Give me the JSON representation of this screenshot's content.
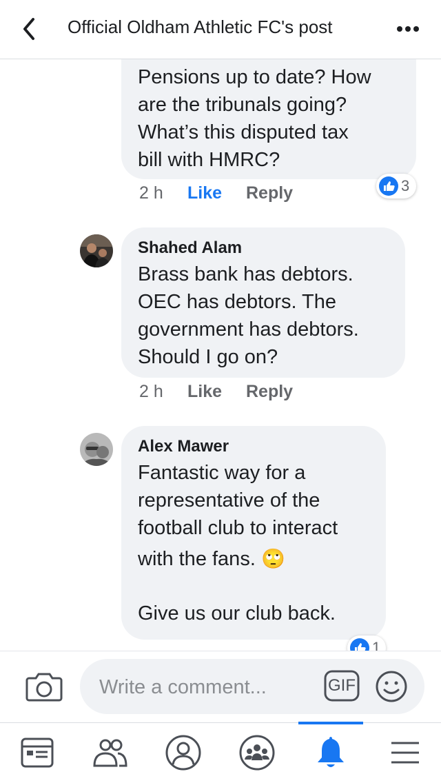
{
  "header": {
    "title": "Official Oldham Athletic FC's post",
    "back_icon": "chevron-left-icon",
    "more_icon": "ellipsis-icon"
  },
  "comments": [
    {
      "text_lines": [
        "Pensions up to date? How",
        "are the tribunals going?",
        "What’s this disputed tax",
        "bill with HMRC?"
      ],
      "time": "2 h",
      "like_label": "Like",
      "reply_label": "Reply",
      "liked": true,
      "reaction_count": "3",
      "reaction_icon": "thumbs-up-icon"
    },
    {
      "author": "Shahed Alam",
      "text_lines": [
        "Brass bank has debtors.",
        "OEC has debtors. The",
        "government has debtors.",
        "Should I go on?"
      ],
      "time": "2 h",
      "like_label": "Like",
      "reply_label": "Reply",
      "liked": false
    },
    {
      "author": "Alex Mawer",
      "text_lines": [
        "Fantastic way for a",
        "representative of the",
        "football club to interact",
        "with the fans.",
        "",
        "Give us our club back."
      ],
      "emoji": "🙄",
      "reaction_count": "1",
      "reaction_icon": "thumbs-up-icon"
    }
  ],
  "composer": {
    "placeholder": "Write a comment...",
    "camera_icon": "camera-icon",
    "gif_label": "GIF",
    "emoji_icon": "smiley-icon"
  },
  "tabbar": {
    "tabs": [
      {
        "name": "news-feed",
        "icon": "news-feed-icon"
      },
      {
        "name": "friends",
        "icon": "friends-icon"
      },
      {
        "name": "profile",
        "icon": "profile-icon"
      },
      {
        "name": "groups",
        "icon": "groups-icon"
      },
      {
        "name": "notifications",
        "icon": "bell-icon",
        "active": true
      },
      {
        "name": "menu",
        "icon": "hamburger-menu-icon"
      }
    ]
  },
  "colors": {
    "accent": "#1877f2",
    "bubble": "#f0f2f5",
    "meta_text": "#65676b"
  }
}
